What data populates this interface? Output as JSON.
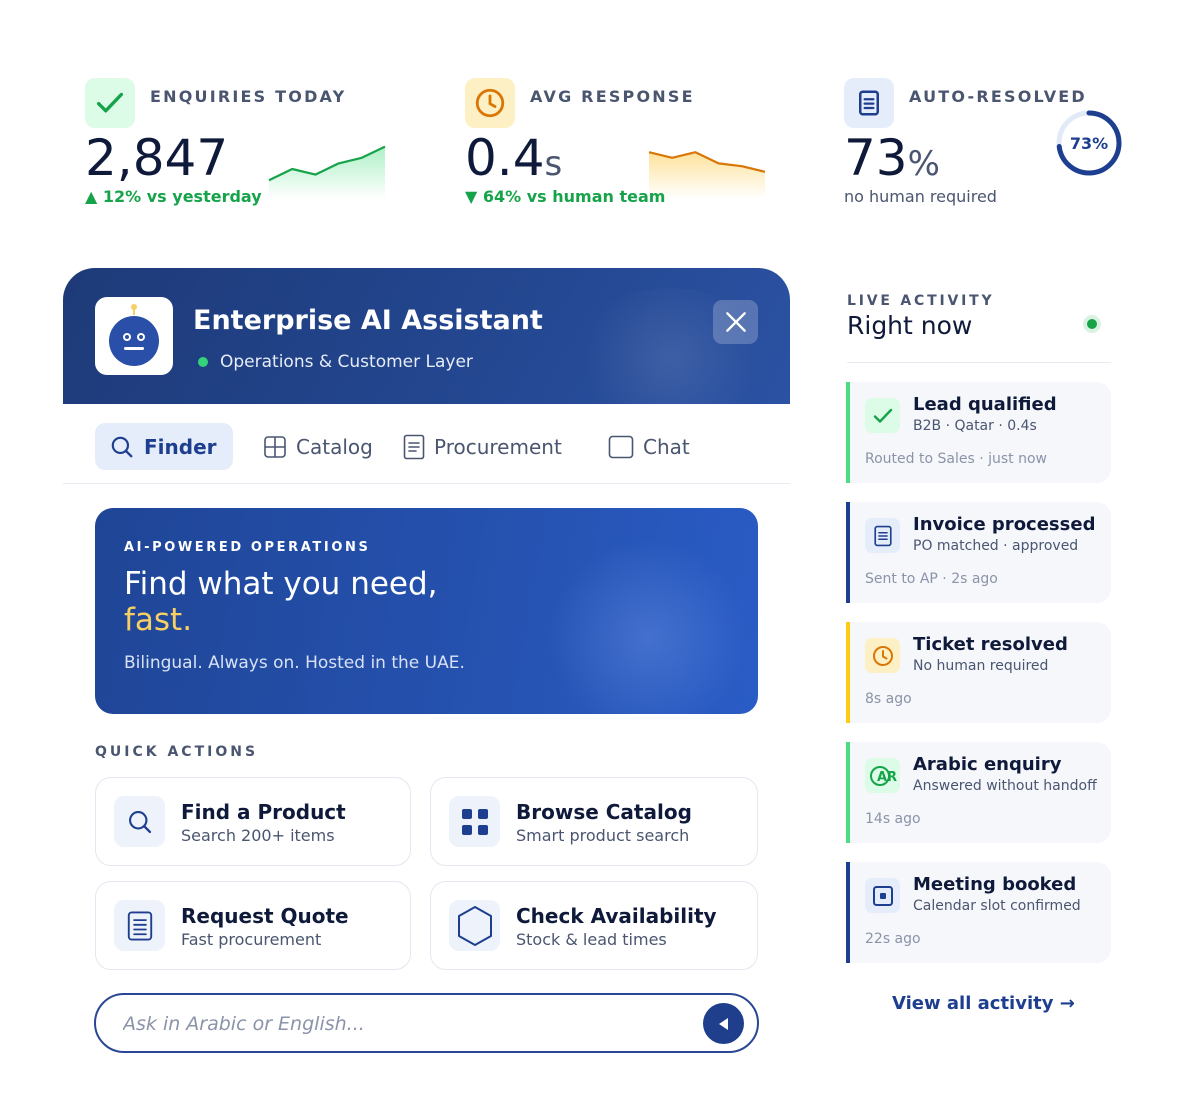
{
  "colors": {
    "accent": "#1e3f8f",
    "success": "#16a34a",
    "warning": "#d97706",
    "hero_highlight": "#f7cf63"
  },
  "stats": [
    {
      "icon": "check-icon",
      "label": "ENQUIRIES TODAY",
      "value": "2,847",
      "unit": "",
      "footnote": "▲ 12% vs yesterday",
      "trend_points": [
        3,
        5,
        4,
        6,
        7,
        9
      ]
    },
    {
      "icon": "clock-icon",
      "label": "AVG RESPONSE",
      "value": "0.4",
      "unit": "s",
      "footnote": "▼ 64% vs human team",
      "trend_points": [
        8,
        7,
        8,
        6,
        5.5,
        4.5
      ]
    },
    {
      "icon": "document-icon",
      "label": "AUTO-RESOLVED",
      "value": "73",
      "unit": "%",
      "footnote": "no human required",
      "ring_value": 0.73,
      "ring_label": "73%"
    }
  ],
  "assistant": {
    "avatar_icon": "robot-icon",
    "title": "Enterprise AI Assistant",
    "subtitle": "Operations & Customer Layer",
    "close_icon": "close-icon",
    "tabs": [
      {
        "label": "Finder",
        "icon": "search-icon",
        "active": true
      },
      {
        "label": "Catalog",
        "icon": "grid-icon",
        "active": false
      },
      {
        "label": "Procurement",
        "icon": "document-icon",
        "active": false
      },
      {
        "label": "Chat",
        "icon": "chat-icon",
        "active": false
      }
    ],
    "hero": {
      "eyebrow": "AI-POWERED OPERATIONS",
      "title": "Find what you need,",
      "accent": "fast.",
      "description": "Bilingual. Always on. Hosted in the UAE."
    },
    "quick_actions_heading": "QUICK ACTIONS",
    "quick_actions": [
      {
        "title": "Find a Product",
        "subtitle": "Search 200+ items",
        "icon": "search-icon"
      },
      {
        "title": "Browse Catalog",
        "subtitle": "Smart product search",
        "icon": "grid-icon"
      },
      {
        "title": "Request Quote",
        "subtitle": "Fast procurement",
        "icon": "document-icon"
      },
      {
        "title": "Check Availability",
        "subtitle": "Stock & lead times",
        "icon": "hexagon-icon"
      }
    ],
    "input": {
      "placeholder": "Ask in Arabic or English...",
      "value": ""
    },
    "send_icon": "send-icon"
  },
  "activity": {
    "eyebrow": "LIVE ACTIVITY",
    "title": "Right now",
    "items": [
      {
        "title": "Lead qualified",
        "subtitle": "B2B · Qatar · 0.4s",
        "time": "Routed to Sales · just now",
        "icon": "check-icon",
        "color": "#4ade80"
      },
      {
        "title": "Invoice processed",
        "subtitle": "PO matched · approved",
        "time": "Sent to AP · 2s ago",
        "icon": "document-icon",
        "color": "#1e3f8f"
      },
      {
        "title": "Ticket resolved",
        "subtitle": "No human required",
        "time": "8s ago",
        "icon": "clock-icon",
        "color": "#facc15"
      },
      {
        "title": "Arabic enquiry",
        "subtitle": "Answered without handoff",
        "time": "14s ago",
        "icon": "arabic-icon",
        "color": "#4ade80"
      },
      {
        "title": "Meeting booked",
        "subtitle": "Calendar slot confirmed",
        "time": "22s ago",
        "icon": "calendar-icon",
        "color": "#1e3f8f"
      }
    ],
    "view_all": "View all activity →"
  }
}
